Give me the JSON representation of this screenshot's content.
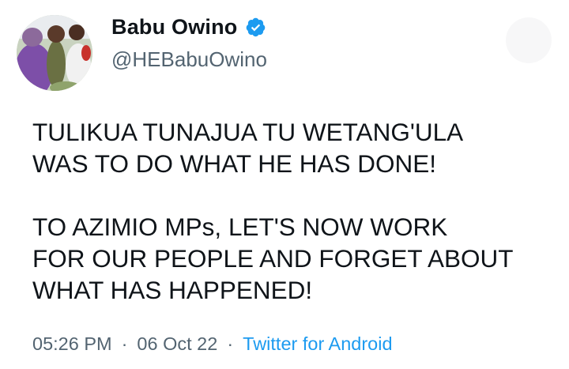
{
  "author": {
    "display_name": "Babu Owino",
    "handle": "@HEBabuOwino",
    "verified_icon": "verified-badge-icon",
    "verified_color": "#1d9bf0"
  },
  "tweet": {
    "paragraphs": [
      "TULIKUA TUNAJUA TU WETANG'ULA\nWAS TO DO WHAT HE HAS DONE!",
      "TO AZIMIO MPs, LET'S NOW WORK\nFOR OUR PEOPLE AND FORGET ABOUT\nWHAT HAS HAPPENED!"
    ]
  },
  "meta": {
    "time": "05:26 PM",
    "separator": "·",
    "date": "06 Oct 22",
    "source": "Twitter for Android"
  },
  "colors": {
    "text": "#0f1419",
    "secondary": "#536471",
    "link": "#1d9bf0"
  }
}
